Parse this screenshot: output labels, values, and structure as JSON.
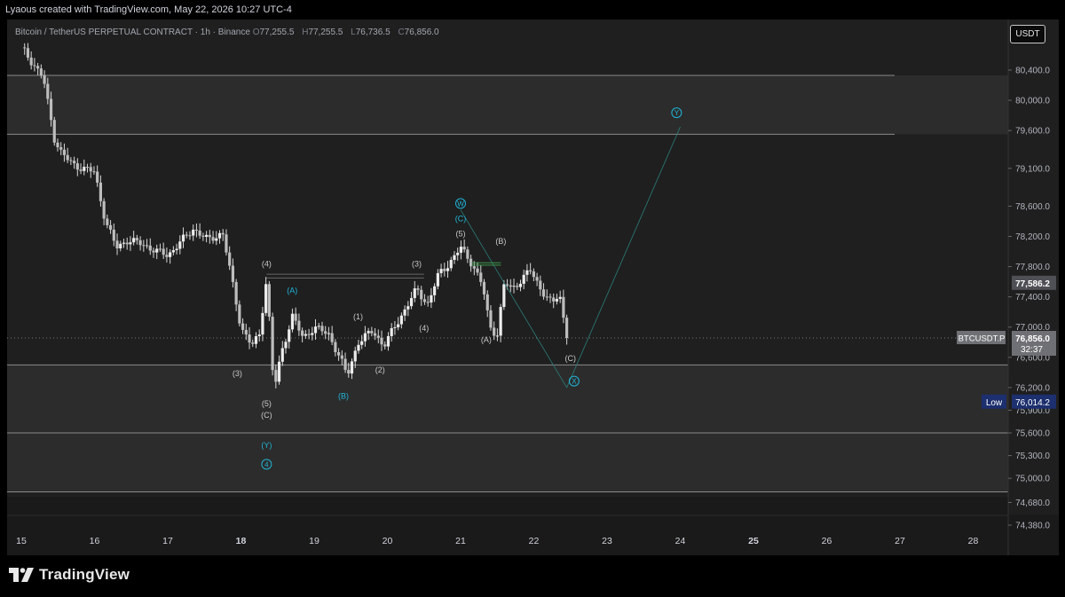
{
  "caption": "Lyaous created with TradingView.com, May 22, 2026 10:27 UTC-4",
  "legend": {
    "symbol": "Bitcoin / TetherUS PERPETUAL CONTRACT · 1h · Binance",
    "o_label": "O",
    "o": "77,255.5",
    "h_label": "H",
    "h": "77,255.5",
    "l_label": "L",
    "l": "76,736.5",
    "c_label": "C",
    "c": "76,856.0"
  },
  "currency_button": "USDT",
  "brand": "TradingView",
  "colors": {
    "background": "#1f1f1f",
    "candle": "#e0e0e0",
    "label_white": "#c8c8c8",
    "label_cyan": "#1fb5d9",
    "low_badge": "#1c2f6e",
    "price_tag": "#6f7075"
  },
  "chart_data": {
    "type": "candlestick",
    "interval": "1h",
    "symbol": "BTCUSDT.P",
    "price_axis": {
      "ticks": [
        80400,
        80000,
        79600,
        79100,
        78600,
        78200,
        77800,
        77400,
        77000,
        76600,
        76200,
        75900,
        75600,
        75300,
        75000,
        74680,
        74380
      ],
      "tick_labels": [
        "80,400.0",
        "80,000.0",
        "79,600.0",
        "79,100.0",
        "78,600.0",
        "78,200.0",
        "77,800.0",
        "77,400.0",
        "77,000.0",
        "76,600.0",
        "76,200.0",
        "75,900.0",
        "75,600.0",
        "75,300.0",
        "75,000.0",
        "74,680.0",
        "74,380.0"
      ],
      "ylim": [
        74260,
        80900
      ]
    },
    "time_axis": {
      "labels": [
        "15",
        "16",
        "17",
        "18",
        "19",
        "20",
        "21",
        "22",
        "23",
        "24",
        "25",
        "26",
        "27",
        "28"
      ],
      "bold": [
        "18",
        "25"
      ]
    },
    "close_path": [
      [
        15.0,
        80700
      ],
      [
        15.15,
        80500
      ],
      [
        15.3,
        80300
      ],
      [
        15.45,
        79500
      ],
      [
        15.55,
        79300
      ],
      [
        15.7,
        79150
      ],
      [
        15.85,
        79100
      ],
      [
        16.0,
        79050
      ],
      [
        16.15,
        78400
      ],
      [
        16.3,
        78050
      ],
      [
        16.45,
        78150
      ],
      [
        16.65,
        78100
      ],
      [
        16.85,
        78000
      ],
      [
        17.0,
        77950
      ],
      [
        17.2,
        78150
      ],
      [
        17.35,
        78300
      ],
      [
        17.55,
        78150
      ],
      [
        17.75,
        78250
      ],
      [
        17.9,
        77500
      ],
      [
        18.0,
        77000
      ],
      [
        18.15,
        76750
      ],
      [
        18.25,
        76900
      ],
      [
        18.35,
        77650
      ],
      [
        18.45,
        76150
      ],
      [
        18.55,
        76650
      ],
      [
        18.7,
        77150
      ],
      [
        18.85,
        76850
      ],
      [
        19.0,
        77000
      ],
      [
        19.2,
        76900
      ],
      [
        19.35,
        76600
      ],
      [
        19.45,
        76350
      ],
      [
        19.6,
        76800
      ],
      [
        19.8,
        76950
      ],
      [
        19.95,
        76750
      ],
      [
        20.1,
        77000
      ],
      [
        20.25,
        77250
      ],
      [
        20.4,
        77500
      ],
      [
        20.55,
        77300
      ],
      [
        20.7,
        77700
      ],
      [
        20.85,
        77850
      ],
      [
        21.0,
        78050
      ],
      [
        21.15,
        77850
      ],
      [
        21.3,
        77550
      ],
      [
        21.4,
        77000
      ],
      [
        21.5,
        76900
      ],
      [
        21.6,
        77600
      ],
      [
        21.7,
        77500
      ],
      [
        21.8,
        77600
      ],
      [
        21.95,
        77750
      ],
      [
        22.1,
        77500
      ],
      [
        22.25,
        77300
      ],
      [
        22.35,
        77450
      ],
      [
        22.45,
        76856
      ]
    ],
    "horizontal_levels": [
      {
        "price": 80330,
        "style": "solid"
      },
      {
        "price": 79550,
        "style": "solid"
      },
      {
        "price": 76856,
        "style": "dotted"
      },
      {
        "price": 76500,
        "style": "solid"
      },
      {
        "price": 75600,
        "style": "solid"
      },
      {
        "price": 74820,
        "style": "solid"
      }
    ],
    "zones": [
      {
        "from": 79550,
        "to": 80330
      },
      {
        "from": 74820,
        "to": 76500
      }
    ],
    "projection": [
      [
        21.0,
        78550
      ],
      [
        22.45,
        76200
      ],
      [
        24.0,
        79650
      ]
    ],
    "wave_labels_white": [
      {
        "t": "(4)",
        "day": 18.35,
        "price": 77800
      },
      {
        "t": "(3)",
        "day": 17.95,
        "price": 76350
      },
      {
        "t": "(5)",
        "day": 18.35,
        "price": 75950
      },
      {
        "t": "(C)",
        "day": 18.35,
        "price": 75800
      },
      {
        "t": "(1)",
        "day": 19.6,
        "price": 77100
      },
      {
        "t": "(2)",
        "day": 19.9,
        "price": 76400
      },
      {
        "t": "(3)",
        "day": 20.4,
        "price": 77800
      },
      {
        "t": "(4)",
        "day": 20.5,
        "price": 76950
      },
      {
        "t": "(5)",
        "day": 21.0,
        "price": 78200
      },
      {
        "t": "(B)",
        "day": 21.55,
        "price": 78100
      },
      {
        "t": "(A)",
        "day": 21.35,
        "price": 76800
      },
      {
        "t": "(C)",
        "day": 22.5,
        "price": 76550
      }
    ],
    "wave_labels_cyan": [
      {
        "t": "(A)",
        "day": 18.7,
        "price": 77450
      },
      {
        "t": "(B)",
        "day": 19.4,
        "price": 76050
      },
      {
        "t": "(Y)",
        "day": 18.35,
        "price": 75400
      },
      {
        "t": "(C)",
        "day": 21.0,
        "price": 78400
      },
      {
        "t": "W",
        "day": 21.0,
        "price": 78600,
        "circled": true
      },
      {
        "t": "X",
        "day": 22.55,
        "price": 76250,
        "circled": true
      },
      {
        "t": "Y",
        "day": 23.95,
        "price": 79800,
        "circled": true
      },
      {
        "t": "4",
        "day": 18.35,
        "price": 75150,
        "circled": true
      }
    ],
    "last_price_tag": {
      "symbol": "BTCUSDT.P",
      "price": "76,856.0",
      "countdown": "32:37"
    },
    "low_tag": {
      "label": "Low",
      "price": "76,014.2"
    },
    "tag_77586": "77,586.2"
  }
}
